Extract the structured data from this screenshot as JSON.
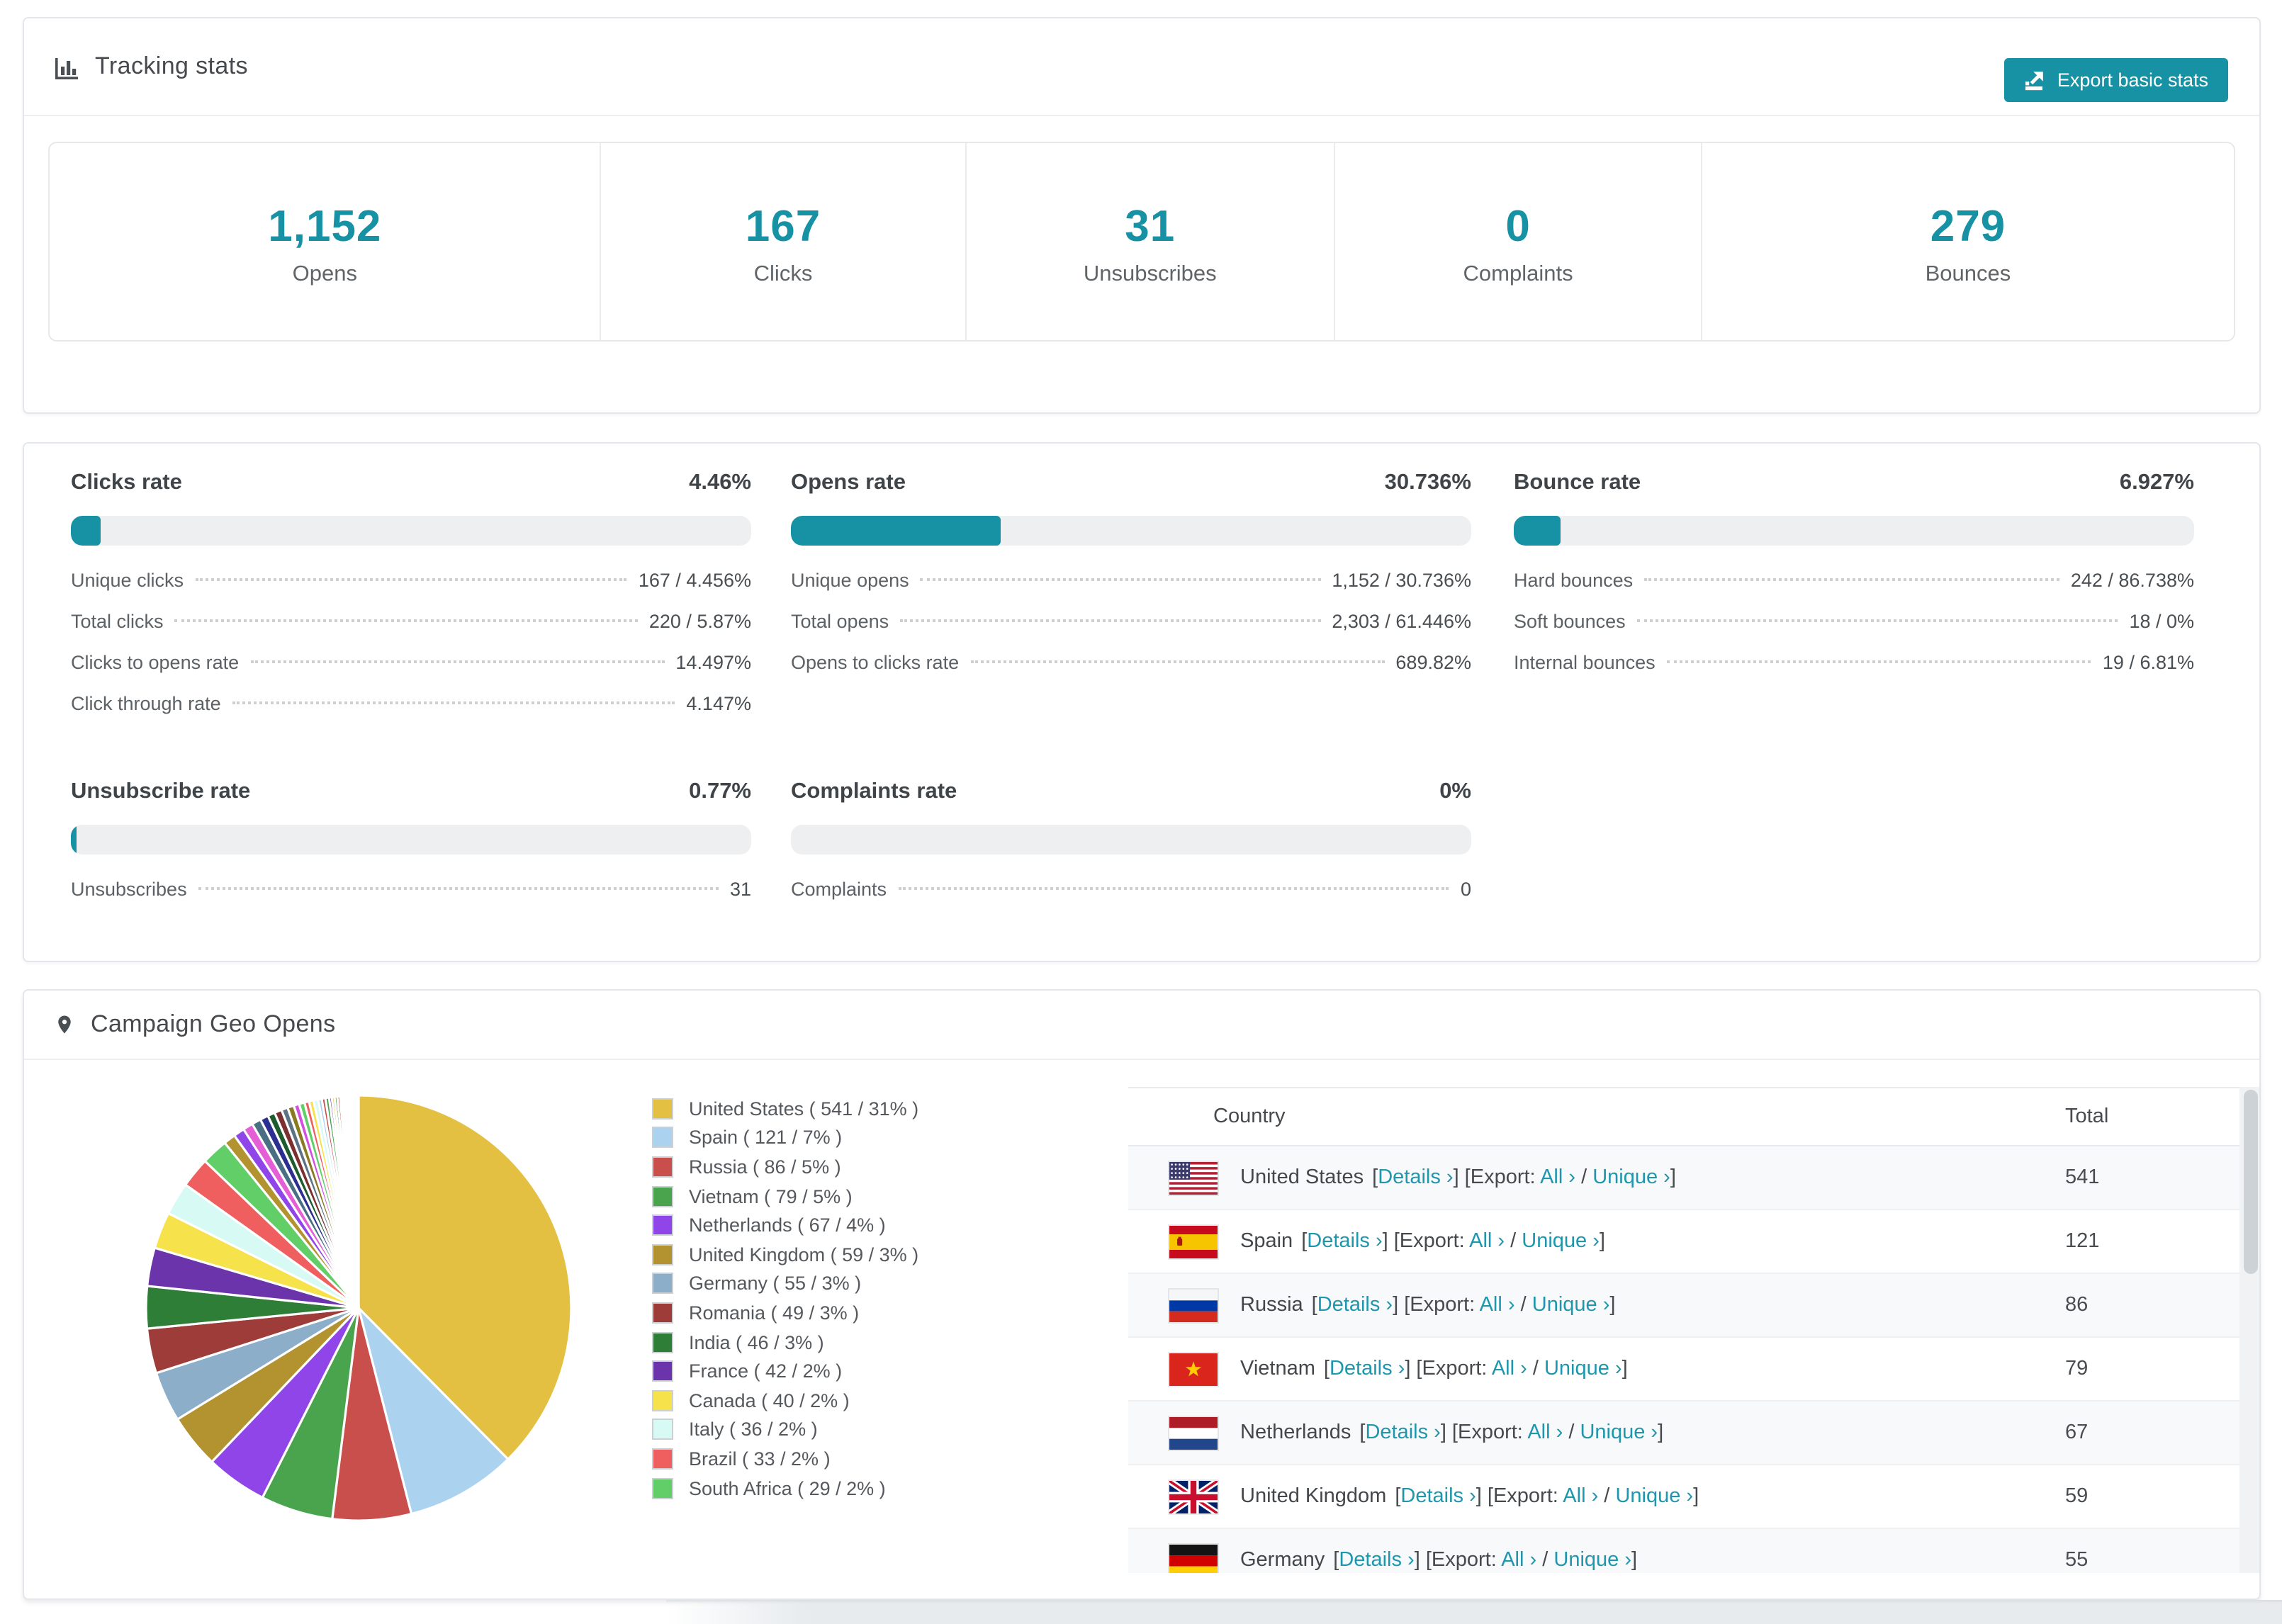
{
  "tracking": {
    "title": "Tracking stats",
    "export_button": "Export basic stats",
    "stats": [
      {
        "value": "1,152",
        "label": "Opens"
      },
      {
        "value": "167",
        "label": "Clicks"
      },
      {
        "value": "31",
        "label": "Unsubscribes"
      },
      {
        "value": "0",
        "label": "Complaints"
      },
      {
        "value": "279",
        "label": "Bounces"
      }
    ]
  },
  "rates": {
    "clicks": {
      "title": "Clicks rate",
      "percent_label": "4.46%",
      "progress": 4.46,
      "rows": [
        {
          "label": "Unique clicks",
          "value": "167 / 4.456%"
        },
        {
          "label": "Total clicks",
          "value": "220 / 5.87%"
        },
        {
          "label": "Clicks to opens rate",
          "value": "14.497%"
        },
        {
          "label": "Click through rate",
          "value": "4.147%"
        }
      ]
    },
    "opens": {
      "title": "Opens rate",
      "percent_label": "30.736%",
      "progress": 30.736,
      "rows": [
        {
          "label": "Unique opens",
          "value": "1,152 / 30.736%"
        },
        {
          "label": "Total opens",
          "value": "2,303 / 61.446%"
        },
        {
          "label": "Opens to clicks rate",
          "value": "689.82%"
        }
      ]
    },
    "bounce": {
      "title": "Bounce rate",
      "percent_label": "6.927%",
      "progress": 6.927,
      "rows": [
        {
          "label": "Hard bounces",
          "value": "242 / 86.738%"
        },
        {
          "label": "Soft bounces",
          "value": "18 / 0%"
        },
        {
          "label": "Internal bounces",
          "value": "19 / 6.81%"
        }
      ]
    },
    "unsubscribe": {
      "title": "Unsubscribe rate",
      "percent_label": "0.77%",
      "progress": 0.77,
      "rows": [
        {
          "label": "Unsubscribes",
          "value": "31"
        }
      ]
    },
    "complaints": {
      "title": "Complaints rate",
      "percent_label": "0%",
      "progress": 0,
      "rows": [
        {
          "label": "Complaints",
          "value": "0"
        }
      ]
    }
  },
  "geo": {
    "title": "Campaign Geo Opens",
    "table": {
      "columns": [
        "Country",
        "Total"
      ],
      "link_labels": {
        "details": "Details ›",
        "export_prefix": "Export:",
        "all": "All ›",
        "separator": "/",
        "unique": "Unique ›"
      },
      "rows": [
        {
          "country": "United States",
          "flag": "us",
          "total": "541"
        },
        {
          "country": "Spain",
          "flag": "es",
          "total": "121"
        },
        {
          "country": "Russia",
          "flag": "ru",
          "total": "86"
        },
        {
          "country": "Vietnam",
          "flag": "vn",
          "total": "79"
        },
        {
          "country": "Netherlands",
          "flag": "nl",
          "total": "67"
        },
        {
          "country": "United Kingdom",
          "flag": "gb",
          "total": "59"
        },
        {
          "country": "Germany",
          "flag": "de",
          "total": "55"
        }
      ]
    }
  },
  "chart_data": {
    "type": "pie",
    "title": "Campaign Geo Opens",
    "start_angle_deg": 0,
    "direction": "clockwise",
    "legend_position": "right",
    "labels": [
      "United States",
      "Spain",
      "Russia",
      "Vietnam",
      "Netherlands",
      "United Kingdom",
      "Germany",
      "Romania",
      "India",
      "France",
      "Canada",
      "Italy",
      "Brazil",
      "South Africa"
    ],
    "values": [
      541,
      121,
      86,
      79,
      67,
      59,
      55,
      49,
      46,
      42,
      40,
      36,
      33,
      29
    ],
    "percent_labels": [
      31,
      7,
      5,
      5,
      4,
      3,
      3,
      3,
      3,
      2,
      2,
      2,
      2,
      2
    ],
    "colors": [
      "#e3bf42",
      "#abd3f0",
      "#c94f4d",
      "#4aa44d",
      "#8f45e8",
      "#b2932f",
      "#8caec9",
      "#9e3c3a",
      "#2f7e38",
      "#6c34ab",
      "#f6e24b",
      "#d8faf4",
      "#ef5f5f",
      "#61ce67"
    ],
    "others_slice_values_estimated": [
      13,
      12,
      11,
      10,
      9,
      8,
      8,
      7,
      7,
      6,
      6,
      5,
      5,
      5,
      4,
      4,
      4,
      3,
      3,
      3,
      3,
      2,
      2,
      2,
      2,
      2,
      2,
      1,
      1,
      1,
      1,
      1,
      1,
      1,
      1
    ],
    "others_colors_cycle": [
      "#b2932f",
      "#8f45e8",
      "#e45fd5",
      "#4a6f82",
      "#2c2f8f",
      "#1e5c2e",
      "#7c2f2f",
      "#5d7284",
      "#8a7a22",
      "#d24fe0",
      "#61ce67",
      "#ef5f5f",
      "#f6e24b",
      "#d8faf4",
      "#abd3f0",
      "#c94f4d",
      "#4aa44d",
      "#6c34ab",
      "#e3bf42",
      "#2f7e38",
      "#9e3c3a",
      "#8caec9"
    ]
  }
}
